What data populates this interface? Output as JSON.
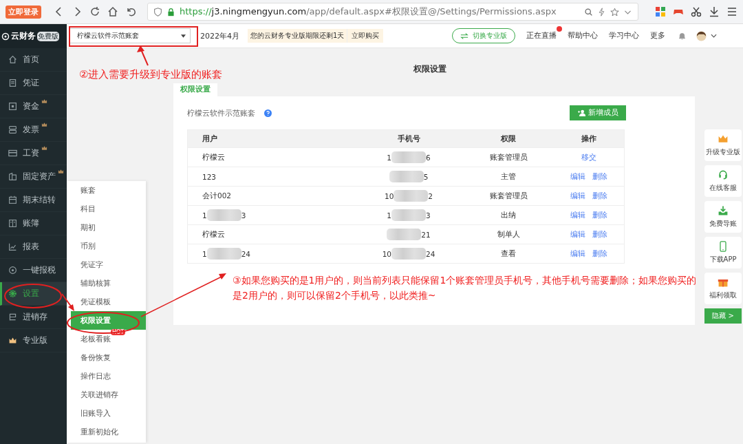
{
  "browser": {
    "login_badge": "立即登录",
    "url_scheme": "https://",
    "url_host": "j3.ningmengyun.com",
    "url_path": "/app/default.aspx#权限设置@/Settings/Permissions.aspx"
  },
  "header": {
    "logo": "云财务",
    "edition": "免费版",
    "account_select": "柠檬云软件示范账套",
    "period": "2022年4月",
    "notice": "您的云财务专业版期限还剩1天",
    "buy": "立即购买",
    "switch": "切换专业版",
    "links": [
      {
        "label": "正在直播",
        "live": true
      },
      {
        "label": "帮助中心",
        "live": false
      },
      {
        "label": "学习中心",
        "live": false
      },
      {
        "label": "更多",
        "live": false
      }
    ]
  },
  "sidebar": {
    "items": [
      {
        "label": "首页",
        "crown": false,
        "selected": false
      },
      {
        "label": "凭证",
        "crown": false,
        "selected": false
      },
      {
        "label": "资金",
        "crown": true,
        "selected": false
      },
      {
        "label": "发票",
        "crown": true,
        "selected": false
      },
      {
        "label": "工资",
        "crown": true,
        "selected": false
      },
      {
        "label": "固定资产",
        "crown": true,
        "selected": false
      },
      {
        "label": "期末结转",
        "crown": false,
        "selected": false
      },
      {
        "label": "账簿",
        "crown": false,
        "selected": false
      },
      {
        "label": "报表",
        "crown": false,
        "selected": false
      },
      {
        "label": "一键报税",
        "crown": false,
        "selected": false
      },
      {
        "label": "设置",
        "crown": false,
        "selected": true
      },
      {
        "label": "进销存",
        "crown": false,
        "selected": false
      },
      {
        "label": "专业版",
        "crown": false,
        "selected": false
      }
    ]
  },
  "submenu": [
    {
      "label": "账套",
      "selected": false,
      "hot": false
    },
    {
      "label": "科目",
      "selected": false,
      "hot": false
    },
    {
      "label": "期初",
      "selected": false,
      "hot": false
    },
    {
      "label": "币别",
      "selected": false,
      "hot": false
    },
    {
      "label": "凭证字",
      "selected": false,
      "hot": false
    },
    {
      "label": "辅助核算",
      "selected": false,
      "hot": false
    },
    {
      "label": "凭证模板",
      "selected": false,
      "hot": false
    },
    {
      "label": "权限设置",
      "selected": true,
      "hot": false
    },
    {
      "label": "老板看账",
      "selected": false,
      "hot": true
    },
    {
      "label": "备份恢复",
      "selected": false,
      "hot": false
    },
    {
      "label": "操作日志",
      "selected": false,
      "hot": false
    },
    {
      "label": "关联进销存",
      "selected": false,
      "hot": false
    },
    {
      "label": "旧账导入",
      "selected": false,
      "hot": false
    },
    {
      "label": "重新初始化",
      "selected": false,
      "hot": false
    }
  ],
  "hot_badge": "HOT",
  "page": {
    "title": "权限设置",
    "tab": "权限设置",
    "account": "柠檬云软件示范账套",
    "add_button": "新增成员",
    "table": {
      "columns": [
        "用户",
        "手机号",
        "权限",
        "操作"
      ],
      "rows": [
        {
          "user": {
            "start": "柠檬云",
            "blurred": false
          },
          "phone": {
            "start": "1",
            "end": "6",
            "blurred": true
          },
          "role": "账套管理员",
          "actions": [
            "移交"
          ]
        },
        {
          "user": {
            "start": "123",
            "blurred": false
          },
          "phone": {
            "end": "5",
            "blurred": true
          },
          "role": "主管",
          "actions": [
            "编辑",
            "删除"
          ]
        },
        {
          "user": {
            "start": "会计002",
            "blurred": false
          },
          "phone": {
            "start": "10",
            "end": "2",
            "blurred": true
          },
          "role": "账套管理员",
          "actions": [
            "编辑",
            "删除"
          ]
        },
        {
          "user": {
            "start": "1",
            "end": "3",
            "blurred": true
          },
          "phone": {
            "start": "1",
            "end": "3",
            "blurred": true
          },
          "role": "出纳",
          "actions": [
            "编辑",
            "删除"
          ]
        },
        {
          "user": {
            "start": "柠檬云",
            "blurred": false
          },
          "phone": {
            "end": "21",
            "blurred": true
          },
          "role": "制单人",
          "actions": [
            "编辑",
            "删除"
          ]
        },
        {
          "user": {
            "start": "1",
            "end": "24",
            "blurred": true
          },
          "phone": {
            "start": "10",
            "end": "24",
            "blurred": true
          },
          "role": "查看",
          "actions": [
            "编辑",
            "删除"
          ]
        }
      ]
    }
  },
  "tools": [
    "升级专业版",
    "在线客服",
    "免费导账",
    "下载APP",
    "福利领取"
  ],
  "hide_button": "隐藏 >",
  "annotations": [
    "②进入需要升级到专业版的账套",
    "③如果您购买的是1用户的，则当前列表只能保留1个账套管理员手机号，其他手机号需要删除；如果您购买的是2用户的，则可以保留2个手机号，以此类推~"
  ]
}
